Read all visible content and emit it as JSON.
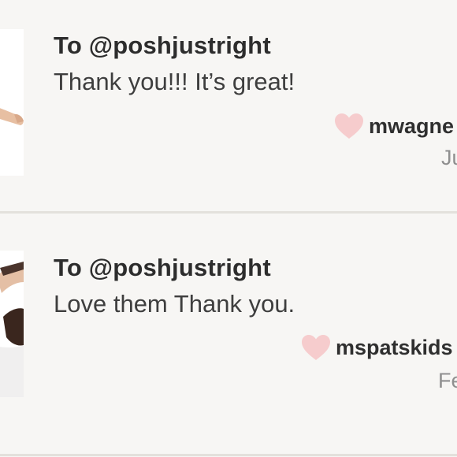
{
  "comments": [
    {
      "recipient": "To @poshjustright",
      "message": "Thank you!!! It’s great!",
      "username": "mwagne",
      "date": "Ju"
    },
    {
      "recipient": "To @poshjustright",
      "message": "Love them Thank you.",
      "username": "mspatskids",
      "date": "Fe"
    }
  ],
  "colors": {
    "background": "#f7f6f4",
    "heart": "#f6cccd",
    "divider": "#e3e1dc",
    "text_dark": "#2d2d2d",
    "text_muted": "#8f8f8f"
  },
  "icons": {
    "like": "heart-icon"
  }
}
